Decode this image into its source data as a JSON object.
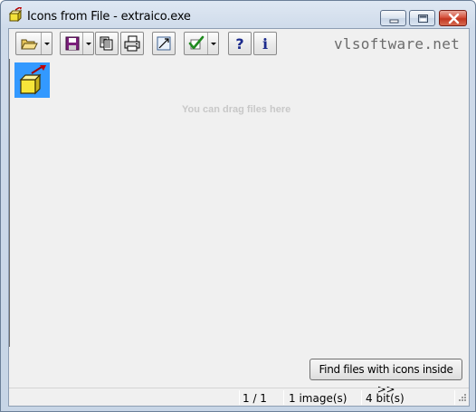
{
  "window": {
    "title": "Icons from File - extraico.exe"
  },
  "toolbar": {
    "buttons": [
      {
        "name": "open",
        "icon": "folder-open-icon",
        "has_dropdown": true
      },
      {
        "name": "save",
        "icon": "floppy-disk-icon",
        "has_dropdown": true
      },
      {
        "name": "copy",
        "icon": "copy-icon"
      },
      {
        "name": "print",
        "icon": "printer-icon"
      },
      {
        "name": "resize",
        "icon": "resize-image-icon"
      },
      {
        "name": "select",
        "icon": "checkmark-icon",
        "has_dropdown": true
      },
      {
        "name": "help",
        "icon": "question-mark-icon",
        "label": "?"
      },
      {
        "name": "about",
        "icon": "info-icon",
        "label": "i"
      }
    ],
    "brand": "vlsoftware.net"
  },
  "panel": {
    "drag_hint": "You can drag files here",
    "icons": [
      {
        "icon": "extraico-app-icon",
        "selected": true
      }
    ]
  },
  "find_button": {
    "label": "Find files with icons inside >>"
  },
  "status": {
    "page": "1 / 1",
    "images": "1 image(s)",
    "bits": "4 bit(s)"
  },
  "colors": {
    "selection": "#3399ff",
    "brand_text": "#6c6c6c",
    "hint_text": "#c8c8c8"
  }
}
